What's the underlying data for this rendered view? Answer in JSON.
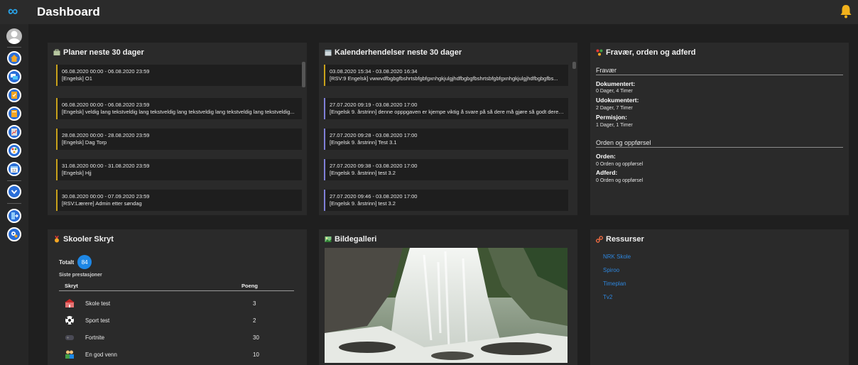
{
  "header": {
    "logo": "∞",
    "title": "Dashboard"
  },
  "sidebar": {
    "items": [
      "home-icon",
      "chat-icon",
      "tasks-icon",
      "book-icon",
      "report-icon",
      "absence-icon",
      "calendar-icon",
      "expand-icon",
      "logout-icon",
      "settings-icon"
    ]
  },
  "plans": {
    "title": "Planer neste 30 dager",
    "events": [
      {
        "l1": "06.08.2020 00:00 - 06.08.2020 23:59",
        "l2": "[Engelsk] O1"
      },
      {
        "l1": "06.08.2020 00:00 - 06.08.2020 23:59",
        "l2": "[Engelsk] veldig lang tekstveldig lang tekstveldig lang tekstveldig lang tekstveldig lang tekstveldig..."
      },
      {
        "l1": "28.08.2020 00:00 - 28.08.2020 23:59",
        "l2": "[Engelsk] Dag Torp"
      },
      {
        "l1": "31.08.2020 00:00 - 31.08.2020 23:59",
        "l2": "[Engelsk] Hjj"
      },
      {
        "l1": "30.08.2020 00:00 - 07.09.2020 23:59",
        "l2": "[RSV:Lærere] Admin etter søndag"
      }
    ]
  },
  "calendar": {
    "title": "Kalenderhendelser neste 30 dager",
    "events": [
      {
        "l1": "03.08.2020 15:34 - 03.08.2020 16:34",
        "l2": "[RSV:9 Engelsk] vwwvdfbgbgfbshrtsbfgbfgxnhgkjulgjhdfbgbgfbshrtsbfgbfgxnhgkjulgjhdfbgbgfbs..."
      },
      {
        "l1": "27.07.2020 09:19 - 03.08.2020 17:00",
        "l2": "[Engelsk 9. årstrinn] denne opppgaven er kjempe viktig å svare på så dere må gjøre så godt dere ..."
      },
      {
        "l1": "27.07.2020 09:28 - 03.08.2020 17:00",
        "l2": "[Engelsk 9. årstrinn] Test 3.1"
      },
      {
        "l1": "27.07.2020 09:38 - 03.08.2020 17:00",
        "l2": "[Engelsk 9. årstrinn] test 3.2"
      },
      {
        "l1": "27.07.2020 09:46 - 03.08.2020 17:00",
        "l2": "[Engelsk 9. årstrinn] test 3.2"
      }
    ]
  },
  "absence": {
    "title": "Fravær, orden og adferd",
    "fravaer_heading": "Fravær",
    "dokumentert_label": "Dokumentert:",
    "dokumentert_value": "0 Dager, 4 Timer",
    "udokumentert_label": "Udokumentert:",
    "udokumentert_value": "2 Dager, 7 Timer",
    "permisjon_label": "Permisjon:",
    "permisjon_value": "1 Dager, 1 Timer",
    "orden_heading": "Orden og oppførsel",
    "orden_label": "Orden:",
    "orden_value": "0 Orden og oppførsel",
    "adferd_label": "Adferd:",
    "adferd_value": "0 Orden og oppførsel"
  },
  "skryt": {
    "title": "Skooler Skryt",
    "total_label": "Totalt",
    "total_value": "84",
    "subtitle": "Siste prestasjoner",
    "col_skryt": "Skryt",
    "col_poeng": "Poeng",
    "rows": [
      {
        "icon": "school-icon",
        "name": "Skole test",
        "points": "3"
      },
      {
        "icon": "soccer-ball-icon",
        "name": "Sport test",
        "points": "2"
      },
      {
        "icon": "gamepad-icon",
        "name": "Fortnite",
        "points": "30"
      },
      {
        "icon": "friends-icon",
        "name": "En god venn",
        "points": "10"
      }
    ]
  },
  "gallery": {
    "title": "Bildegalleri"
  },
  "resources": {
    "title": "Ressurser",
    "links": [
      "NRK Skole",
      "Spiroo",
      "Timeplan",
      "Tv2"
    ]
  },
  "colors": {
    "accent": "#29a3e8",
    "plan_border": "#c9a21b",
    "calendar_border": "#7f7fd8",
    "link": "#2e86dd",
    "badge": "#1e87e5"
  }
}
